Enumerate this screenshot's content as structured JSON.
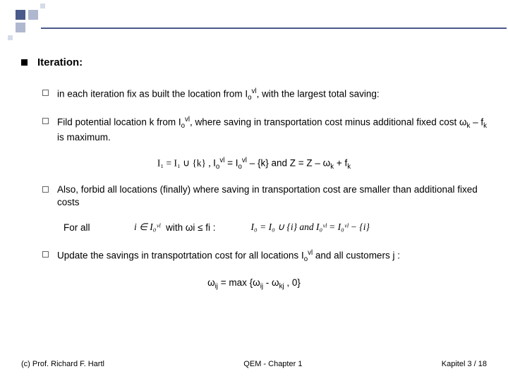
{
  "heading": "Iteration:",
  "items": {
    "i0_a": "in each iteration fix as built the location from I",
    "i0_b": ", with the largest total saving:",
    "i1_a": "Fild potential location k from I",
    "i1_b": ", where saving in transportation cost minus additional fixed cost ω",
    "i1_c": " – f",
    "i1_d": "  is maximum.",
    "i2": "Also, forbid all locations (finally) where saving in transportation cost are smaller than additional fixed costs",
    "i3_a": "Update the savings in transpotrtation cost for all locations I",
    "i3_b": " and all customers j :"
  },
  "sub_o": "o",
  "sup_vl": "vl",
  "sub_k": "k",
  "formula1_lhs": "I₁ = I₁ ∪ {k} ,   ",
  "formula1_rhs_a": "I",
  "formula1_rhs_b": " = I",
  "formula1_rhs_c": " – {k} and Z = Z – ω",
  "formula1_rhs_d": " + f",
  "forall_label": "For all",
  "forall_math": "i ∈ I₀ᵛˡ",
  "forall_mid": " with ωi ≤ fi :",
  "forall_rhs": "I₀ = I₀ ∪ {i} and I₀ᵛˡ = I₀ᵛˡ − {i}",
  "formula3_a": "ω",
  "formula3_b": " = max {ω",
  "formula3_c": " - ω",
  "formula3_d": ", 0}",
  "sub_ij": "ij",
  "sub_kj": "kj",
  "footer": {
    "left": "(c) Prof. Richard F. Hartl",
    "center": "QEM - Chapter 1",
    "right": "Kapitel 3 / 18"
  }
}
